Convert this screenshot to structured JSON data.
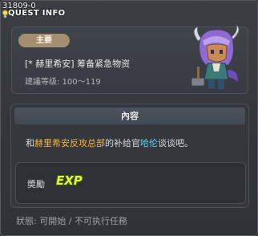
{
  "window": {
    "quest_id": "31809-0",
    "title": "QUEST INFO"
  },
  "info": {
    "tag_label": "主要",
    "quest_name": "[* 赫里希安] 筹备紧急物资",
    "level_text": "建議等级: 100～119"
  },
  "content": {
    "header": "內容",
    "text_prefix": "和",
    "org_name": "赫里希安反攻总部",
    "text_middle": "的补给官",
    "npc_name": "哈伦",
    "text_suffix": "谈谈吧。"
  },
  "reward": {
    "label": "奬勵",
    "exp_label": "EXP"
  },
  "status": "狀態: 可開始 / 不可执行任務",
  "colors": {
    "org_highlight": "#f5b33c",
    "npc_highlight": "#69d3ee",
    "exp_color": "#e4f43a",
    "tag_bg": "#a58e70"
  }
}
